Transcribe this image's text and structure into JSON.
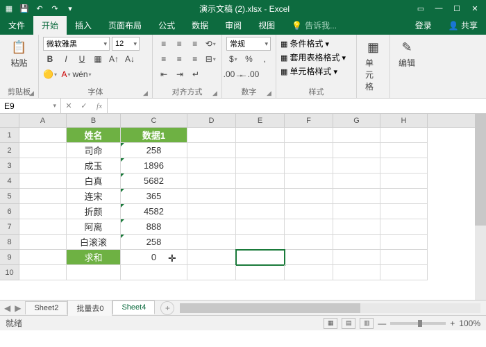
{
  "titlebar": {
    "title": "演示文稿 (2).xlsx - Excel"
  },
  "tabs": {
    "file": "文件",
    "home": "开始",
    "insert": "插入",
    "layout": "页面布局",
    "formula": "公式",
    "data": "数据",
    "review": "审阅",
    "view": "视图",
    "tell": "告诉我...",
    "login": "登录",
    "share": "共享"
  },
  "ribbon": {
    "clipboard": "剪贴板",
    "paste": "粘贴",
    "font": "字体",
    "fontname": "微软雅黑",
    "fontsize": "12",
    "align": "对齐方式",
    "number": "数字",
    "numfmt": "常规",
    "styles": "样式",
    "cond": "条件格式",
    "tablefmt": "套用表格格式",
    "cellstyle": "单元格样式",
    "cells": "单元格",
    "edit": "编辑"
  },
  "namebox": "E9",
  "cols": [
    "A",
    "B",
    "C",
    "D",
    "E",
    "F",
    "G",
    "H"
  ],
  "table": {
    "headers": {
      "b": "姓名",
      "c": "数据1"
    },
    "rows": [
      {
        "b": "司命",
        "c": "258"
      },
      {
        "b": "成玉",
        "c": "1896"
      },
      {
        "b": "白真",
        "c": "5682"
      },
      {
        "b": "连宋",
        "c": "365"
      },
      {
        "b": "折颜",
        "c": "4582"
      },
      {
        "b": "阿离",
        "c": "888"
      },
      {
        "b": "白滚滚",
        "c": "258"
      }
    ],
    "sum": {
      "b": "求和",
      "c": "0"
    }
  },
  "sheets": {
    "s1": "Sheet2",
    "s2": "批量去0",
    "s3": "Sheet4"
  },
  "status": {
    "ready": "就绪",
    "zoom": "100%"
  }
}
